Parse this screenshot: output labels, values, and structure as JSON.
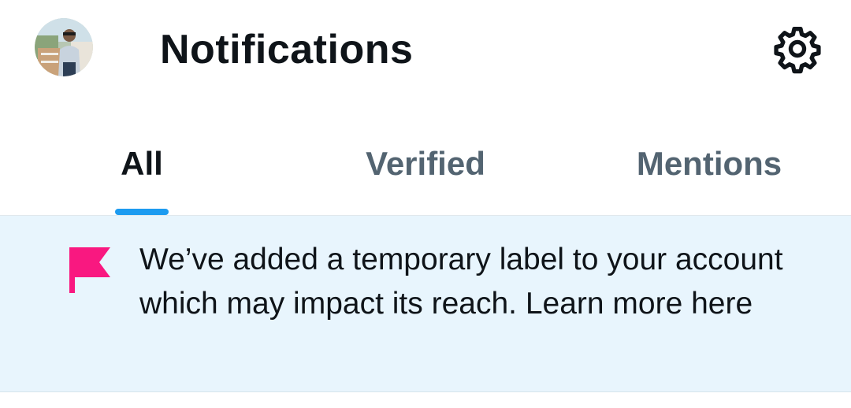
{
  "header": {
    "title": "Notifications",
    "avatar_icon": "user-avatar",
    "settings_icon": "gear-icon"
  },
  "tabs": [
    {
      "label": "All",
      "active": true
    },
    {
      "label": "Verified",
      "active": false
    },
    {
      "label": "Mentions",
      "active": false
    }
  ],
  "notice": {
    "icon": "flag-icon",
    "text": "We’ve added a temporary label to your account which may impact its reach. Learn more here"
  },
  "colors": {
    "accent": "#1d9bf0",
    "flag": "#f91880",
    "notice_background": "#e8f5fd",
    "text_primary": "#0f1419",
    "text_secondary": "#536471"
  }
}
